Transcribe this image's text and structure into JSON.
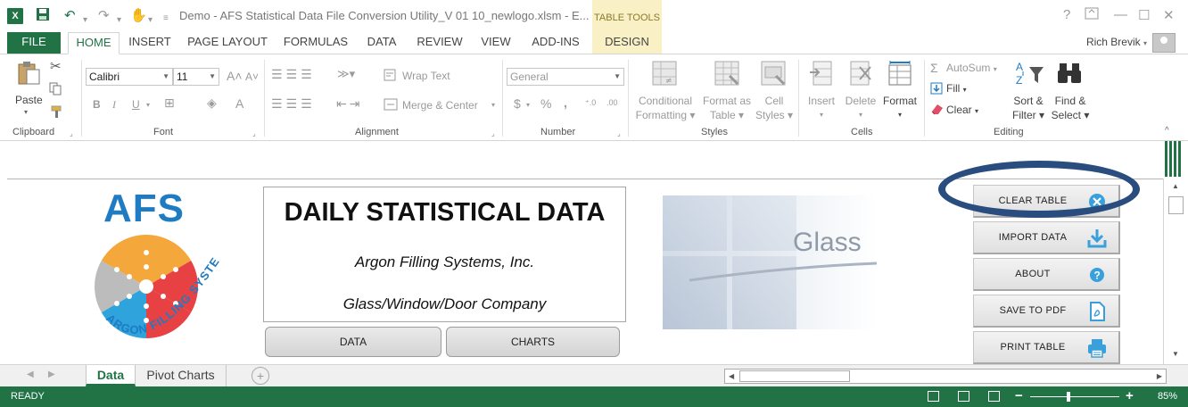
{
  "titlebar": {
    "app_icon": "X",
    "title": "Demo - AFS Statistical Data File Conversion Utility_V 01 10_newlogo.xlsm - E...",
    "table_tools": "TABLE TOOLS",
    "help": "?",
    "minimize": "—",
    "restore": "☐",
    "close": "✕"
  },
  "tabs": {
    "file": "FILE",
    "home": "HOME",
    "insert": "INSERT",
    "page_layout": "PAGE LAYOUT",
    "formulas": "FORMULAS",
    "data": "DATA",
    "review": "REVIEW",
    "view": "VIEW",
    "addins": "ADD-INS",
    "design": "DESIGN"
  },
  "user": {
    "name": "Rich Brevik"
  },
  "ribbon": {
    "clipboard": {
      "label": "Clipboard",
      "paste": "Paste"
    },
    "font": {
      "label": "Font",
      "family": "Calibri",
      "size": "11",
      "bold": "B",
      "italic": "I",
      "underline": "U"
    },
    "alignment": {
      "label": "Alignment",
      "wrap_text": "Wrap Text",
      "merge_center": "Merge & Center"
    },
    "number": {
      "label": "Number",
      "format": "General",
      "currency": "$",
      "percent": "%",
      "comma": ","
    },
    "styles": {
      "label": "Styles",
      "conditional_1": "Conditional",
      "conditional_2": "Formatting",
      "format_table_1": "Format as",
      "format_table_2": "Table",
      "cell_styles_1": "Cell",
      "cell_styles_2": "Styles"
    },
    "cells": {
      "label": "Cells",
      "insert": "Insert",
      "delete": "Delete",
      "format": "Format"
    },
    "editing": {
      "label": "Editing",
      "autosum": "AutoSum",
      "fill": "Fill",
      "clear": "Clear",
      "sort_1": "Sort &",
      "sort_2": "Filter",
      "find_1": "Find &",
      "find_2": "Select"
    }
  },
  "sheet": {
    "logo_text": "AFS",
    "logo_arc": "ARGON FILLING SYSTEMS, INC.",
    "heading": "DAILY STATISTICAL DATA",
    "company": "Argon Filling Systems, Inc.",
    "segment": "Glass/Window/Door Company",
    "data_button": "DATA",
    "charts_button": "CHARTS",
    "glass_label": "Glass",
    "buttons": {
      "clear": "CLEAR TABLE",
      "import": "IMPORT DATA",
      "about": "ABOUT",
      "save_pdf": "SAVE TO PDF",
      "print": "PRINT TABLE"
    }
  },
  "sheet_tabs": {
    "active": "Data",
    "second": "Pivot Charts",
    "add": "+"
  },
  "status": {
    "ready": "READY",
    "zoom": "85%"
  }
}
